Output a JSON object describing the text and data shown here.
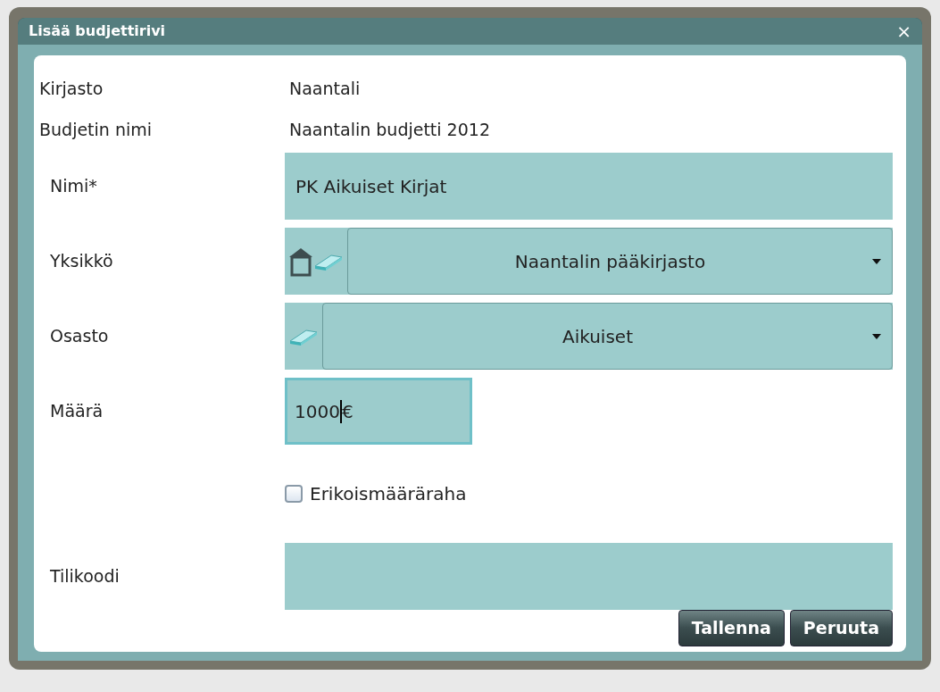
{
  "window": {
    "title": "Lisää budjettirivi",
    "close": "×"
  },
  "info": [
    {
      "label": "Kirjasto",
      "value": "Naantali"
    },
    {
      "label": "Budjetin nimi",
      "value": "Naantalin budjetti 2012"
    }
  ],
  "fields": [
    {
      "kind": "text",
      "label": "Nimi*",
      "value": "PK Aikuiset Kirjat"
    },
    {
      "kind": "unit_select",
      "label": "Yksikkö",
      "value": "Naantalin pääkirjasto"
    },
    {
      "kind": "department_select",
      "label": "Osasto",
      "value": "Aikuiset"
    },
    {
      "kind": "amount",
      "label": "Määrä",
      "value": "1000",
      "unit": "€",
      "focused": true
    },
    {
      "kind": "checkbox",
      "text": "Erikoismääräraha",
      "checked": false
    },
    {
      "kind": "text",
      "label": "Tilikoodi"
    }
  ],
  "buttons": [
    "Tallenna",
    "Peruuta"
  ]
}
